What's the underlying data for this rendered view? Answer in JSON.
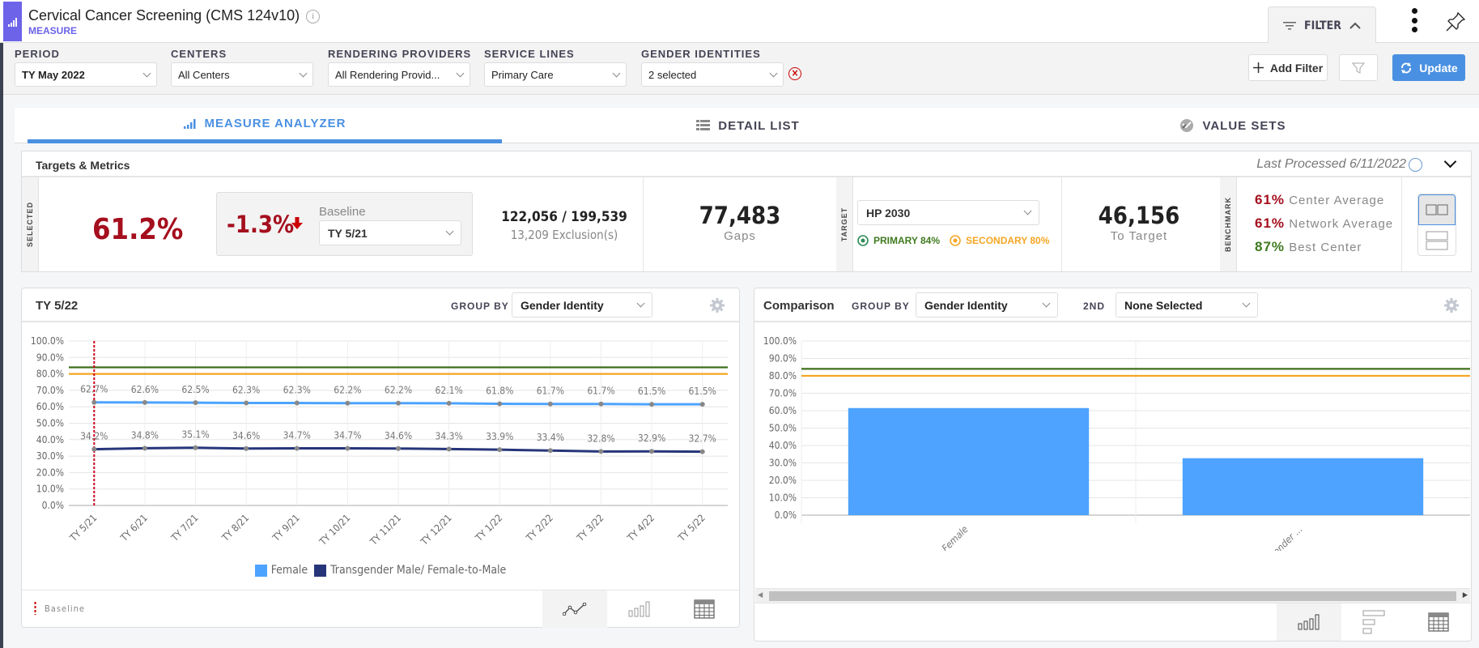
{
  "header": {
    "title": "Cervical Cancer Screening (CMS 124v10)",
    "subtitle": "MEASURE",
    "filter_tab": "FILTER"
  },
  "filters": [
    {
      "label": "PERIOD",
      "value": "TY May 2022"
    },
    {
      "label": "CENTERS",
      "value": "All Centers"
    },
    {
      "label": "RENDERING PROVIDERS",
      "value": "All Rendering Provid..."
    },
    {
      "label": "SERVICE LINES",
      "value": "Primary Care"
    },
    {
      "label": "GENDER IDENTITIES",
      "value": "2 selected"
    }
  ],
  "filterbar": {
    "add_filter": "Add Filter",
    "update": "Update"
  },
  "tabs": [
    {
      "label": "MEASURE ANALYZER",
      "icon": "bar-chart-icon",
      "active": true
    },
    {
      "label": "DETAIL LIST",
      "icon": "list-icon",
      "active": false
    },
    {
      "label": "VALUE SETS",
      "icon": "value-sets-icon",
      "active": false
    }
  ],
  "metrics": {
    "title": "Targets & Metrics",
    "last_processed": "Last Processed 6/11/2022",
    "selected_label": "SELECTED",
    "selected_value": "61.2%",
    "change_value": "-1.3%",
    "baseline_label": "Baseline",
    "baseline_value": "TY 5/21",
    "ratio": "122,056 / 199,539",
    "exclusions": "13,209 Exclusion(s)",
    "gaps_value": "77,483",
    "gaps_label": "Gaps",
    "target_label": "TARGET",
    "target_value": "HP 2030",
    "primary": "PRIMARY 84%",
    "secondary": "SECONDARY 80%",
    "to_target_value": "46,156",
    "to_target_label": "To Target",
    "benchmark_label": "BENCHMARK",
    "benchmarks": [
      {
        "value": "61%",
        "label": "Center Average",
        "color": "#a50f1e"
      },
      {
        "value": "61%",
        "label": "Network Average",
        "color": "#a50f1e"
      },
      {
        "value": "87%",
        "label": "Best Center",
        "color": "#3f7a1f"
      }
    ]
  },
  "trend_panel": {
    "title": "TY 5/22",
    "group_by_label": "GROUP BY",
    "group_by_value": "Gender Identity",
    "baseline_legend": "Baseline"
  },
  "comparison_panel": {
    "title": "Comparison",
    "group_by_label": "GROUP BY",
    "group_by_value": "Gender Identity",
    "second_label": "2ND",
    "second_value": "None Selected"
  },
  "chart_data": [
    {
      "type": "line",
      "title": "TY 5/22",
      "x": [
        "TY 5/21",
        "TY 6/21",
        "TY 7/21",
        "TY 8/21",
        "TY 9/21",
        "TY 10/21",
        "TY 11/21",
        "TY 12/21",
        "TY 1/22",
        "TY 2/22",
        "TY 3/22",
        "TY 4/22",
        "TY 5/22"
      ],
      "series": [
        {
          "name": "Female",
          "color": "#4da3ff",
          "values": [
            62.7,
            62.6,
            62.5,
            62.3,
            62.3,
            62.2,
            62.2,
            62.1,
            61.8,
            61.7,
            61.7,
            61.5,
            61.5
          ]
        },
        {
          "name": "Transgender Male/ Female-to-Male",
          "color": "#26357a",
          "values": [
            34.2,
            34.8,
            35.1,
            34.6,
            34.7,
            34.7,
            34.6,
            34.3,
            33.9,
            33.4,
            32.8,
            32.9,
            32.7
          ]
        }
      ],
      "reference_lines": [
        {
          "name": "Primary target",
          "value": 84,
          "color": "#3f6e1a"
        },
        {
          "name": "Secondary target",
          "value": 80,
          "color": "#f5a623"
        }
      ],
      "baseline_x": "TY 5/21",
      "yticks": [
        "0.0%",
        "10.0%",
        "20.0%",
        "30.0%",
        "40.0%",
        "50.0%",
        "60.0%",
        "70.0%",
        "80.0%",
        "90.0%",
        "100.0%"
      ],
      "ylim": [
        0,
        100
      ],
      "legend": "bottom",
      "grid": true
    },
    {
      "type": "bar",
      "title": "Comparison",
      "categories": [
        "Female",
        "Transgender ..."
      ],
      "values": [
        61.5,
        32.7
      ],
      "color": "#4da3ff",
      "reference_lines": [
        {
          "name": "Primary target",
          "value": 84,
          "color": "#3f6e1a"
        },
        {
          "name": "Secondary target",
          "value": 80,
          "color": "#f5a623"
        }
      ],
      "yticks": [
        "0.0%",
        "10.0%",
        "20.0%",
        "30.0%",
        "40.0%",
        "50.0%",
        "60.0%",
        "70.0%",
        "80.0%",
        "90.0%",
        "100.0%"
      ],
      "ylim": [
        0,
        100
      ],
      "grid": true
    }
  ]
}
